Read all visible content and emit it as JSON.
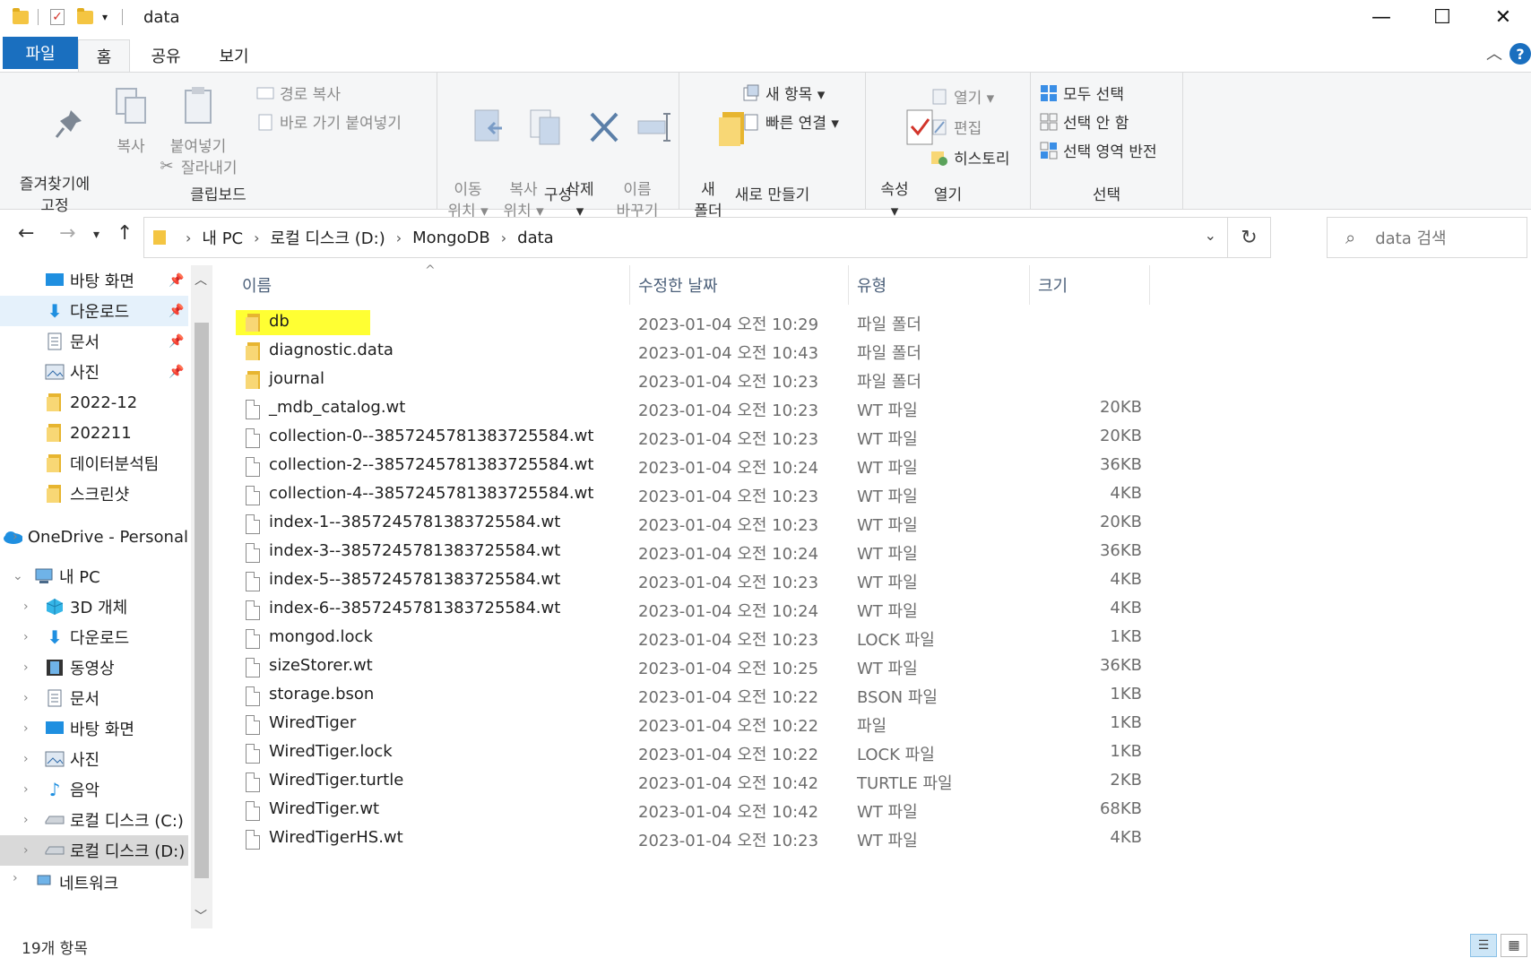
{
  "window": {
    "title": "data",
    "minimize": "—",
    "maximize": "☐",
    "close": "✕"
  },
  "ribbon_tabs": {
    "file": "파일",
    "home": "홈",
    "share": "공유",
    "view": "보기",
    "help": "?"
  },
  "clipboard": {
    "pin": "즐겨찾기에\n고정",
    "copy": "복사",
    "paste": "붙여넣기",
    "copy_path": "경로 복사",
    "paste_shortcut": "바로 가기 붙여넣기",
    "cut": "잘라내기",
    "label": "클립보드"
  },
  "organize": {
    "move_to": "이동\n위치 ▾",
    "copy_to": "복사\n위치 ▾",
    "delete": "삭제\n▾",
    "rename": "이름\n바꾸기",
    "label": "구성"
  },
  "new": {
    "new_folder": "새\n폴더",
    "new_item": "새 항목 ▾",
    "easy_access": "빠른 연결 ▾",
    "label": "새로 만들기"
  },
  "open": {
    "properties": "속성\n▾",
    "open": "열기 ▾",
    "edit": "편집",
    "history": "히스토리",
    "label": "열기"
  },
  "select": {
    "select_all": "모두 선택",
    "select_none": "선택 안 함",
    "invert": "선택 영역 반전",
    "label": "선택"
  },
  "address": {
    "crumbs": [
      "내 PC",
      "로컬 디스크 (D:)",
      "MongoDB",
      "data"
    ],
    "search_placeholder": "data 검색"
  },
  "nav_pane": {
    "quick": [
      {
        "label": "바탕 화면",
        "icon": "desktop-icon"
      },
      {
        "label": "다운로드",
        "icon": "download-icon"
      },
      {
        "label": "문서",
        "icon": "document-icon"
      },
      {
        "label": "사진",
        "icon": "pictures-icon"
      },
      {
        "label": "2022-12",
        "icon": "folder-icon"
      },
      {
        "label": "202211",
        "icon": "folder-icon"
      },
      {
        "label": "데이터분석팀",
        "icon": "folder-icon"
      },
      {
        "label": "스크린샷",
        "icon": "folder-icon"
      }
    ],
    "onedrive": "OneDrive - Personal",
    "this_pc": "내 PC",
    "pc_items": [
      {
        "label": "3D 개체",
        "icon": "3d-objects-icon"
      },
      {
        "label": "다운로드",
        "icon": "download-icon"
      },
      {
        "label": "동영상",
        "icon": "video-icon"
      },
      {
        "label": "문서",
        "icon": "document-icon"
      },
      {
        "label": "바탕 화면",
        "icon": "desktop-icon"
      },
      {
        "label": "사진",
        "icon": "pictures-icon"
      },
      {
        "label": "음악",
        "icon": "music-icon"
      },
      {
        "label": "로컬 디스크 (C:)",
        "icon": "drive-icon"
      },
      {
        "label": "로컬 디스크 (D:)",
        "icon": "drive-icon"
      }
    ],
    "network": "네트워크"
  },
  "columns": {
    "name": "이름",
    "date": "수정한 날짜",
    "type": "유형",
    "size": "크기"
  },
  "files": [
    {
      "name": "db",
      "date": "2023-01-04 오전 10:29",
      "type": "파일 폴더",
      "size": "",
      "kind": "folder"
    },
    {
      "name": "diagnostic.data",
      "date": "2023-01-04 오전 10:43",
      "type": "파일 폴더",
      "size": "",
      "kind": "folder"
    },
    {
      "name": "journal",
      "date": "2023-01-04 오전 10:23",
      "type": "파일 폴더",
      "size": "",
      "kind": "folder"
    },
    {
      "name": "_mdb_catalog.wt",
      "date": "2023-01-04 오전 10:23",
      "type": "WT 파일",
      "size": "20KB",
      "kind": "file"
    },
    {
      "name": "collection-0--3857245781383725584.wt",
      "date": "2023-01-04 오전 10:23",
      "type": "WT 파일",
      "size": "20KB",
      "kind": "file"
    },
    {
      "name": "collection-2--3857245781383725584.wt",
      "date": "2023-01-04 오전 10:24",
      "type": "WT 파일",
      "size": "36KB",
      "kind": "file"
    },
    {
      "name": "collection-4--3857245781383725584.wt",
      "date": "2023-01-04 오전 10:23",
      "type": "WT 파일",
      "size": "4KB",
      "kind": "file"
    },
    {
      "name": "index-1--3857245781383725584.wt",
      "date": "2023-01-04 오전 10:23",
      "type": "WT 파일",
      "size": "20KB",
      "kind": "file"
    },
    {
      "name": "index-3--3857245781383725584.wt",
      "date": "2023-01-04 오전 10:24",
      "type": "WT 파일",
      "size": "36KB",
      "kind": "file"
    },
    {
      "name": "index-5--3857245781383725584.wt",
      "date": "2023-01-04 오전 10:23",
      "type": "WT 파일",
      "size": "4KB",
      "kind": "file"
    },
    {
      "name": "index-6--3857245781383725584.wt",
      "date": "2023-01-04 오전 10:24",
      "type": "WT 파일",
      "size": "4KB",
      "kind": "file"
    },
    {
      "name": "mongod.lock",
      "date": "2023-01-04 오전 10:23",
      "type": "LOCK 파일",
      "size": "1KB",
      "kind": "file"
    },
    {
      "name": "sizeStorer.wt",
      "date": "2023-01-04 오전 10:25",
      "type": "WT 파일",
      "size": "36KB",
      "kind": "file"
    },
    {
      "name": "storage.bson",
      "date": "2023-01-04 오전 10:22",
      "type": "BSON 파일",
      "size": "1KB",
      "kind": "file"
    },
    {
      "name": "WiredTiger",
      "date": "2023-01-04 오전 10:22",
      "type": "파일",
      "size": "1KB",
      "kind": "file"
    },
    {
      "name": "WiredTiger.lock",
      "date": "2023-01-04 오전 10:22",
      "type": "LOCK 파일",
      "size": "1KB",
      "kind": "file"
    },
    {
      "name": "WiredTiger.turtle",
      "date": "2023-01-04 오전 10:42",
      "type": "TURTLE 파일",
      "size": "2KB",
      "kind": "file"
    },
    {
      "name": "WiredTiger.wt",
      "date": "2023-01-04 오전 10:42",
      "type": "WT 파일",
      "size": "68KB",
      "kind": "file"
    },
    {
      "name": "WiredTigerHS.wt",
      "date": "2023-01-04 오전 10:23",
      "type": "WT 파일",
      "size": "4KB",
      "kind": "file"
    }
  ],
  "status": {
    "count": "19개 항목"
  }
}
